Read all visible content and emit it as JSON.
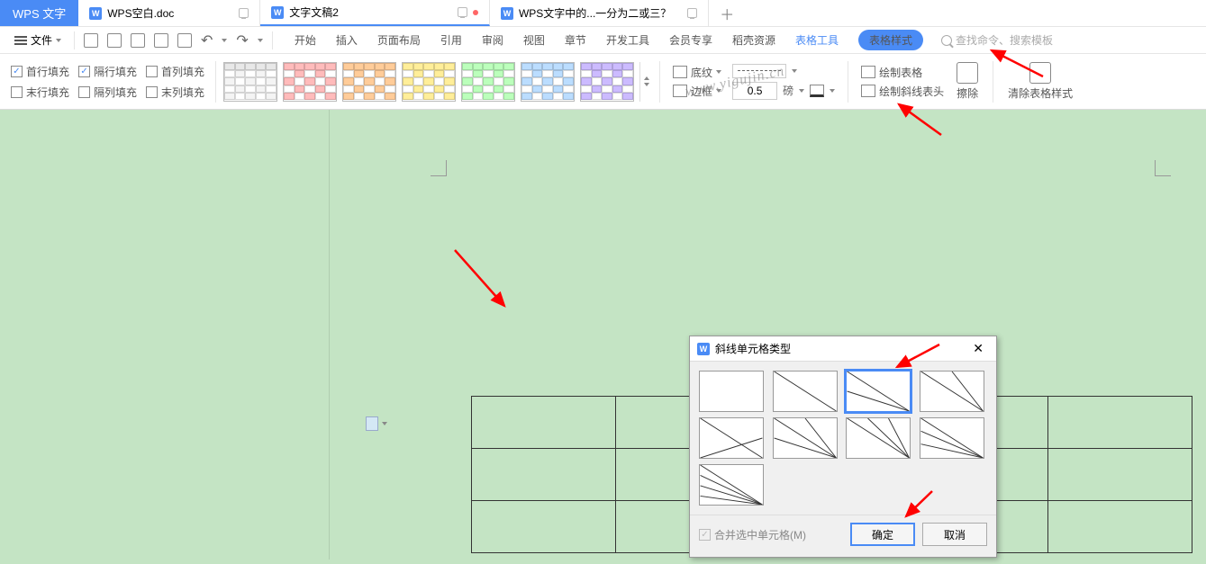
{
  "app_name": "WPS 文字",
  "tabs": [
    {
      "label": "WPS空白.doc"
    },
    {
      "label": "文字文稿2"
    },
    {
      "label": "WPS文字中的...一分为二或三？"
    }
  ],
  "menu": {
    "file": "文件",
    "items": [
      "开始",
      "插入",
      "页面布局",
      "引用",
      "审阅",
      "视图",
      "章节",
      "开发工具",
      "会员专享",
      "稻壳资源"
    ],
    "table_tools": "表格工具",
    "table_style": "表格样式",
    "search_placeholder": "查找命令、搜索模板"
  },
  "ribbon": {
    "fill": {
      "first_row": "首行填充",
      "alt_row": "隔行填充",
      "first_col": "首列填充",
      "last_row": "末行填充",
      "alt_col": "隔列填充",
      "last_col": "末列填充"
    },
    "shading_label": "底纹",
    "border_label": "边框",
    "weight_value": "0.5",
    "weight_unit": "磅",
    "draw_table": "绘制表格",
    "draw_diag": "绘制斜线表头",
    "erase": "擦除",
    "clear_style": "清除表格样式"
  },
  "dialog": {
    "title": "斜线单元格类型",
    "merge_label": "合并选中单元格(M)",
    "ok": "确定",
    "cancel": "取消",
    "selected_index": 2
  },
  "watermark_text": "www.yigujin.cn"
}
